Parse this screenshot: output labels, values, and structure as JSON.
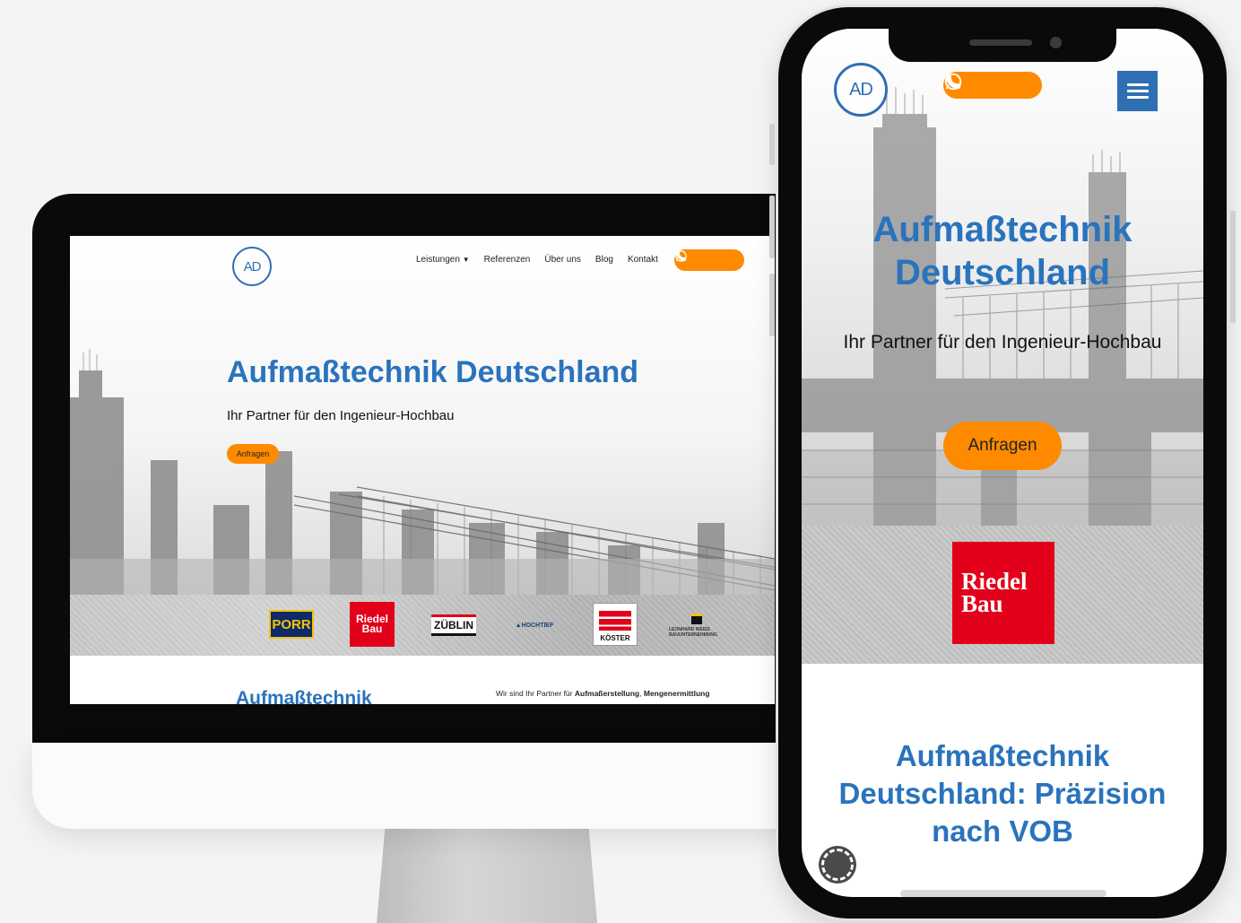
{
  "desktop": {
    "logo_text": "AD",
    "nav": [
      {
        "label": "Leistungen",
        "has_dropdown": true
      },
      {
        "label": "Referenzen"
      },
      {
        "label": "Über uns"
      },
      {
        "label": "Blog"
      },
      {
        "label": "Kontakt"
      }
    ],
    "contact_icons": [
      "whatsapp-icon",
      "phone-icon"
    ],
    "hero_title": "Aufmaßtechnik Deutschland",
    "hero_subtitle": "Ihr Partner für den Ingenieur-Hochbau",
    "cta_label": "Anfragen",
    "partner_logos": {
      "porr": "PORR",
      "riedel": "Riedel Bau",
      "zublin": "ZÜBLIN",
      "hochtief": "HOCHTIEF",
      "koster": "KÖSTER",
      "leonhard_weiss": "LEONHARD WEISS BAUUNTERNEHMUNG"
    },
    "section_title": "Aufmaßtechnik",
    "section_text_prefix": "Wir sind Ihr Partner für ",
    "section_text_bold_1": "Aufmaßerstellung",
    "section_text_sep": ", ",
    "section_text_bold_2": "Mengenermittlung"
  },
  "mobile": {
    "logo_text": "AD",
    "contact_icons": [
      "whatsapp-icon",
      "phone-icon"
    ],
    "hero_title": "Aufmaßtechnik Deutschland",
    "hero_subtitle": "Ihr Partner für den Ingenieur-Hochbau",
    "cta_label": "Anfragen",
    "partner_logo": "Riedel Bau",
    "section_title": "Aufmaßtechnik Deutschland: Präzision nach VOB"
  },
  "colors": {
    "brand_blue": "#2a73bd",
    "accent_orange": "#ff8a00",
    "riedel_red": "#e2001a"
  }
}
